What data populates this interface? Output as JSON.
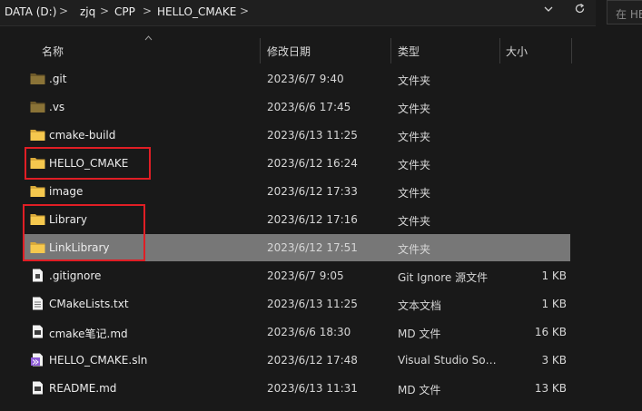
{
  "address_bar": {
    "crumbs": [
      "DATA (D:)",
      "zjq",
      "CPP",
      "HELLO_CMAKE"
    ],
    "separator": ">",
    "dropdown_icon": "chevron-down-icon",
    "refresh_icon": "refresh-icon"
  },
  "search": {
    "placeholder": "在 HE"
  },
  "columns": {
    "name": "名称",
    "modified": "修改日期",
    "type": "类型",
    "size": "大小"
  },
  "rows": [
    {
      "icon": "folder-dim-icon",
      "name": ".git",
      "modified": "2023/6/7 9:40",
      "type": "文件夹",
      "size": ""
    },
    {
      "icon": "folder-dim-icon",
      "name": ".vs",
      "modified": "2023/6/6 17:45",
      "type": "文件夹",
      "size": ""
    },
    {
      "icon": "folder-icon",
      "name": "cmake-build",
      "modified": "2023/6/13 11:25",
      "type": "文件夹",
      "size": ""
    },
    {
      "icon": "folder-icon",
      "name": "HELLO_CMAKE",
      "modified": "2023/6/12 16:24",
      "type": "文件夹",
      "size": ""
    },
    {
      "icon": "folder-icon",
      "name": "image",
      "modified": "2023/6/12 17:33",
      "type": "文件夹",
      "size": ""
    },
    {
      "icon": "folder-icon",
      "name": "Library",
      "modified": "2023/6/12 17:16",
      "type": "文件夹",
      "size": ""
    },
    {
      "icon": "folder-icon",
      "name": "LinkLibrary",
      "modified": "2023/6/12 17:51",
      "type": "文件夹",
      "size": "",
      "selected": true
    },
    {
      "icon": "gitignore-file-icon",
      "name": ".gitignore",
      "modified": "2023/6/7 9:05",
      "type": "Git Ignore 源文件",
      "size": "1 KB"
    },
    {
      "icon": "text-file-icon",
      "name": "CMakeLists.txt",
      "modified": "2023/6/13 11:25",
      "type": "文本文档",
      "size": "1 KB"
    },
    {
      "icon": "markdown-file-icon",
      "name": "cmake笔记.md",
      "modified": "2023/6/6 18:30",
      "type": "MD 文件",
      "size": "16 KB"
    },
    {
      "icon": "visual-studio-solution-icon",
      "name": "HELLO_CMAKE.sln",
      "modified": "2023/6/12 17:48",
      "type": "Visual Studio Sol...",
      "size": "3 KB"
    },
    {
      "icon": "markdown-file-icon",
      "name": "README.md",
      "modified": "2023/6/13 11:31",
      "type": "MD 文件",
      "size": "13 KB"
    }
  ],
  "colors": {
    "background": "#191919",
    "selected_row": "#777777",
    "folder": "#f0c24b",
    "annotation_box": "#e01e25"
  }
}
